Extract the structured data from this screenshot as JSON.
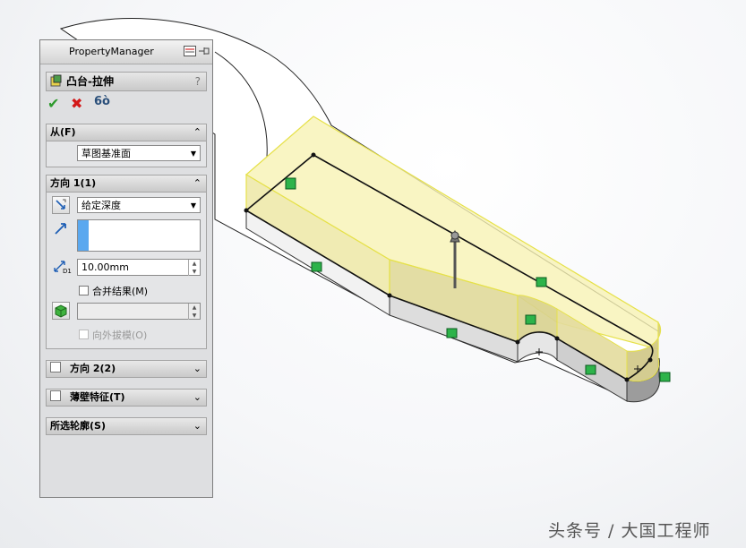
{
  "panel": {
    "title": "PropertyManager",
    "feature_name": "凸台-拉伸",
    "help": "?",
    "actions": {
      "ok": "✔",
      "cancel": "✖",
      "preview": "6ò"
    }
  },
  "from_group": {
    "title": "从(F)",
    "start_condition": "草图基准面"
  },
  "direction1": {
    "title": "方向 1(1)",
    "end_condition": "给定深度",
    "depth": "10.00mm",
    "depth_label": "D1",
    "merge_result": "合并结果(M)",
    "draft_outward": "向外拔模(O)"
  },
  "direction2": {
    "title": "方向 2(2)"
  },
  "thin_feature": {
    "title": "薄壁特征(T)"
  },
  "selected_contours": {
    "title": "所选轮廓(S)"
  },
  "watermark": "头条号 / 大国工程师"
}
